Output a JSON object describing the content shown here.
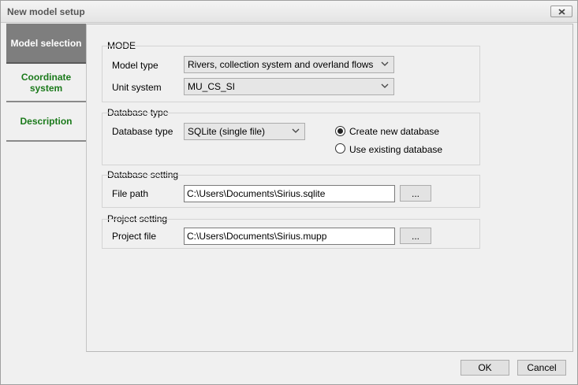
{
  "window": {
    "title": "New model setup"
  },
  "sidebar": {
    "tabs": [
      {
        "label": "Model selection"
      },
      {
        "label": "Coordinate system"
      },
      {
        "label": "Description"
      }
    ]
  },
  "mode": {
    "heading": "MODE",
    "model_type_label": "Model type",
    "model_type_value": "Rivers, collection system and overland flows",
    "unit_system_label": "Unit system",
    "unit_system_value": "MU_CS_SI"
  },
  "database_type": {
    "heading": "Database type",
    "label": "Database type",
    "value": "SQLite (single file)",
    "options": [
      {
        "label": "Create new database",
        "checked": true
      },
      {
        "label": "Use existing database",
        "checked": false
      }
    ]
  },
  "database_setting": {
    "heading": "Database setting",
    "label": "File path",
    "value": "C:\\Users\\Documents\\Sirius.sqlite",
    "browse_label": "..."
  },
  "project_setting": {
    "heading": "Project setting",
    "label": "Project file",
    "value": "C:\\Users\\Documents\\Sirius.mupp",
    "browse_label": "..."
  },
  "footer": {
    "ok_label": "OK",
    "cancel_label": "Cancel"
  }
}
